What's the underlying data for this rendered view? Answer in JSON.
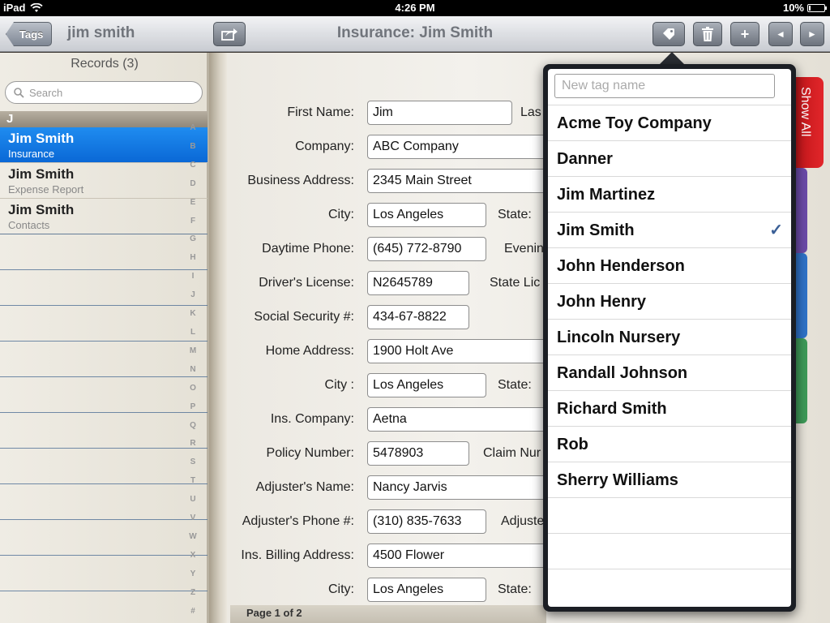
{
  "statusbar": {
    "device": "iPad",
    "time": "4:26 PM",
    "battery": "10%"
  },
  "toolbar": {
    "back_label": "Tags",
    "left_title": "jim smith",
    "center_title": "Insurance: Jim Smith",
    "buttons": {
      "add": "+",
      "prev": "◄",
      "next": "►"
    }
  },
  "sidebar": {
    "title": "Records (3)",
    "search_placeholder": "Search",
    "section": "J",
    "records": [
      {
        "name": "Jim Smith",
        "sub": "Insurance",
        "selected": true
      },
      {
        "name": "Jim Smith",
        "sub": "Expense Report",
        "selected": false
      },
      {
        "name": "Jim Smith",
        "sub": "Contacts",
        "selected": false
      }
    ],
    "index": [
      "A",
      "B",
      "C",
      "D",
      "E",
      "F",
      "G",
      "H",
      "I",
      "J",
      "K",
      "L",
      "M",
      "N",
      "O",
      "P",
      "Q",
      "R",
      "S",
      "T",
      "U",
      "V",
      "W",
      "X",
      "Y",
      "Z",
      "#"
    ]
  },
  "form": {
    "first_name": {
      "label": "First Name:",
      "value": "Jim",
      "extra": "Las"
    },
    "company": {
      "label": "Company:",
      "value": "ABC Company"
    },
    "business_address": {
      "label": "Business Address:",
      "value": "2345 Main Street"
    },
    "city1": {
      "label": "City:",
      "value": "Los Angeles",
      "extra": "State:"
    },
    "daytime_phone": {
      "label": "Daytime Phone:",
      "value": "(645) 772-8790",
      "extra": "Evenin"
    },
    "drivers_license": {
      "label": "Driver's License:",
      "value": "N2645789",
      "extra": "State Lic"
    },
    "ssn": {
      "label": "Social Security #:",
      "value": "434-67-8822"
    },
    "home_address": {
      "label": "Home Address:",
      "value": "1900 Holt Ave"
    },
    "city2": {
      "label": "City :",
      "value": "Los Angeles",
      "extra": "State:"
    },
    "ins_company": {
      "label": "Ins. Company:",
      "value": "Aetna"
    },
    "policy_number": {
      "label": "Policy Number:",
      "value": "5478903",
      "extra": "Claim Nur"
    },
    "adjuster_name": {
      "label": "Adjuster's Name:",
      "value": "Nancy Jarvis"
    },
    "adjuster_phone": {
      "label": "Adjuster's Phone #:",
      "value": "(310) 835-7633",
      "extra": "Adjuste"
    },
    "billing_address": {
      "label": "Ins. Billing Address:",
      "value": "4500 Flower"
    },
    "city3": {
      "label": "City:",
      "value": "Los Angeles",
      "extra": "State:"
    },
    "pager": "Page 1 of 2"
  },
  "right_tab": {
    "label": "Show All"
  },
  "tag_popover": {
    "placeholder": "New tag name",
    "tags": [
      {
        "name": "Acme Toy Company",
        "checked": false
      },
      {
        "name": "Danner",
        "checked": false
      },
      {
        "name": "Jim Martinez",
        "checked": false
      },
      {
        "name": "Jim Smith",
        "checked": true
      },
      {
        "name": "John Henderson",
        "checked": false
      },
      {
        "name": "John Henry",
        "checked": false
      },
      {
        "name": "Lincoln Nursery",
        "checked": false
      },
      {
        "name": "Randall Johnson",
        "checked": false
      },
      {
        "name": "Richard Smith",
        "checked": false
      },
      {
        "name": "Rob",
        "checked": false
      },
      {
        "name": "Sherry Williams",
        "checked": false
      }
    ],
    "check_glyph": "✓"
  },
  "colors": {
    "selection": "#0a68d6",
    "tab_red": "#d21d21",
    "check": "#3a5f96"
  }
}
